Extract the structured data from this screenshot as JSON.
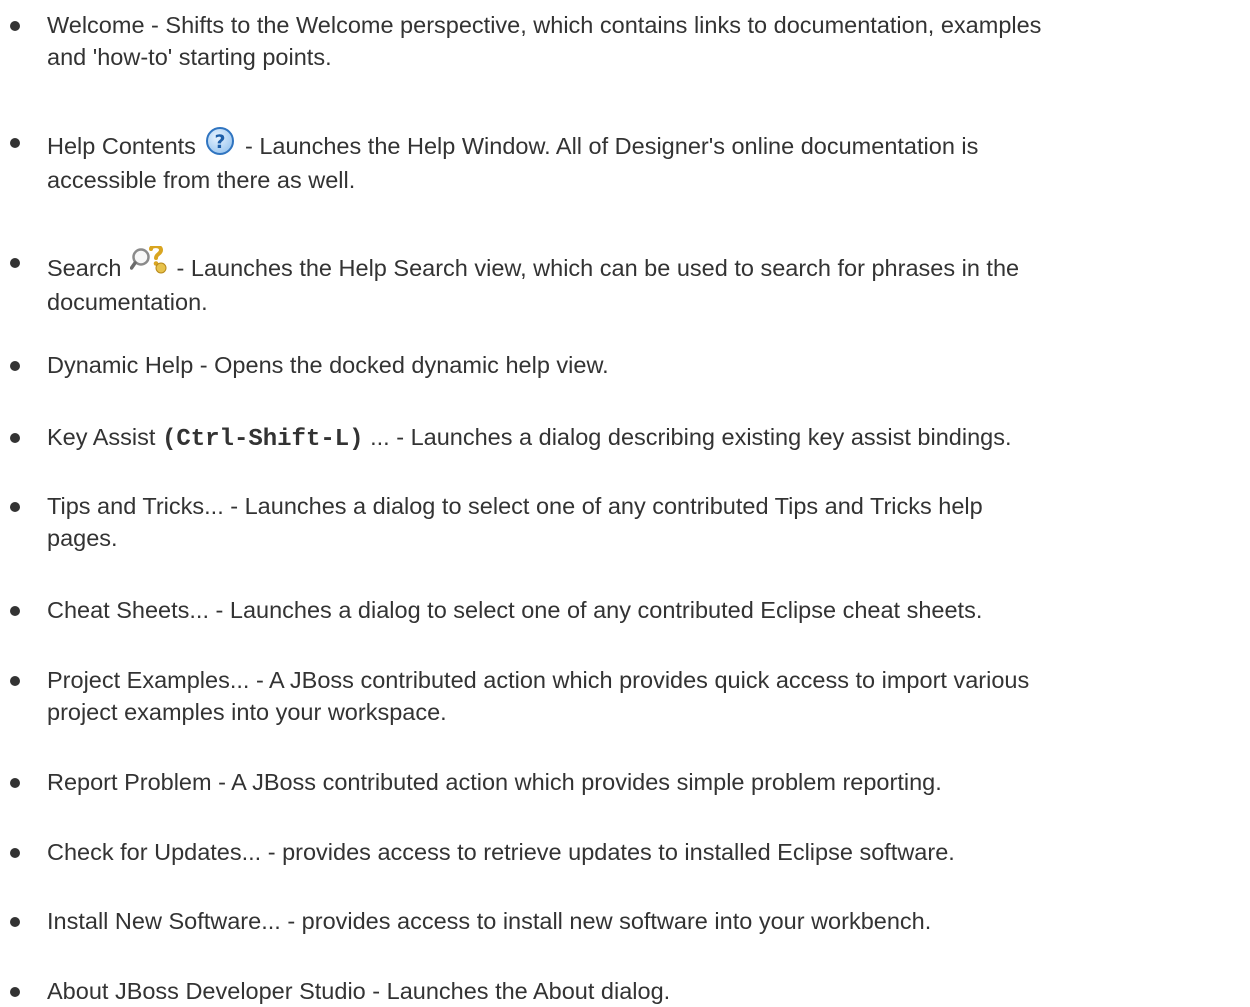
{
  "help_items": [
    {
      "name": "Welcome",
      "line1": "Welcome - Shifts to the Welcome perspective, which contains links to documentation, examples",
      "line2": "and 'how-to' starting points."
    },
    {
      "name": "Help Contents",
      "before_icon": "Help Contents",
      "icon": "help-question-icon",
      "after_icon": "- Launches the Help Window. All of Designer's online documentation is",
      "line2": "accessible from there as well."
    },
    {
      "name": "Search",
      "before_icon": "Search",
      "icon": "help-search-icon",
      "after_icon": "- Launches the Help Search view, which can be used to search for phrases in the",
      "line2": "documentation."
    },
    {
      "name": "Dynamic Help",
      "line1": "Dynamic Help - Opens the docked dynamic help view."
    },
    {
      "name": "Key Assist",
      "before_code": "Key Assist",
      "code": "(Ctrl-Shift-L)",
      "after_code": "... - Launches a dialog describing existing key assist bindings."
    },
    {
      "name": "Tips and Tricks",
      "line1": "Tips and Tricks... - Launches a dialog to select one of any contributed Tips and Tricks help",
      "line2": "pages."
    },
    {
      "name": "Cheat Sheets",
      "line1": "Cheat Sheets... - Launches a dialog to select one of any contributed Eclipse cheat sheets."
    },
    {
      "name": "Project Examples",
      "line1": "Project Examples... - A JBoss contributed action which provides quick access to import various",
      "line2": "project examples into your workspace."
    },
    {
      "name": "Report Problem",
      "line1": "Report Problem - A JBoss contributed action which provides simple problem reporting."
    },
    {
      "name": "Check for Updates",
      "line1": "Check for Updates... - provides access to retrieve updates to installed Eclipse software."
    },
    {
      "name": "Install New Software",
      "line1": "Install New Software... - provides access to install new software into your workbench."
    },
    {
      "name": "About JBoss Developer Studio",
      "line1": "About JBoss Developer Studio - Launches the About dialog."
    }
  ],
  "colors": {
    "text": "#333333",
    "help_icon_blue": "#2f74c0",
    "search_icon_gold": "#d9a520"
  }
}
